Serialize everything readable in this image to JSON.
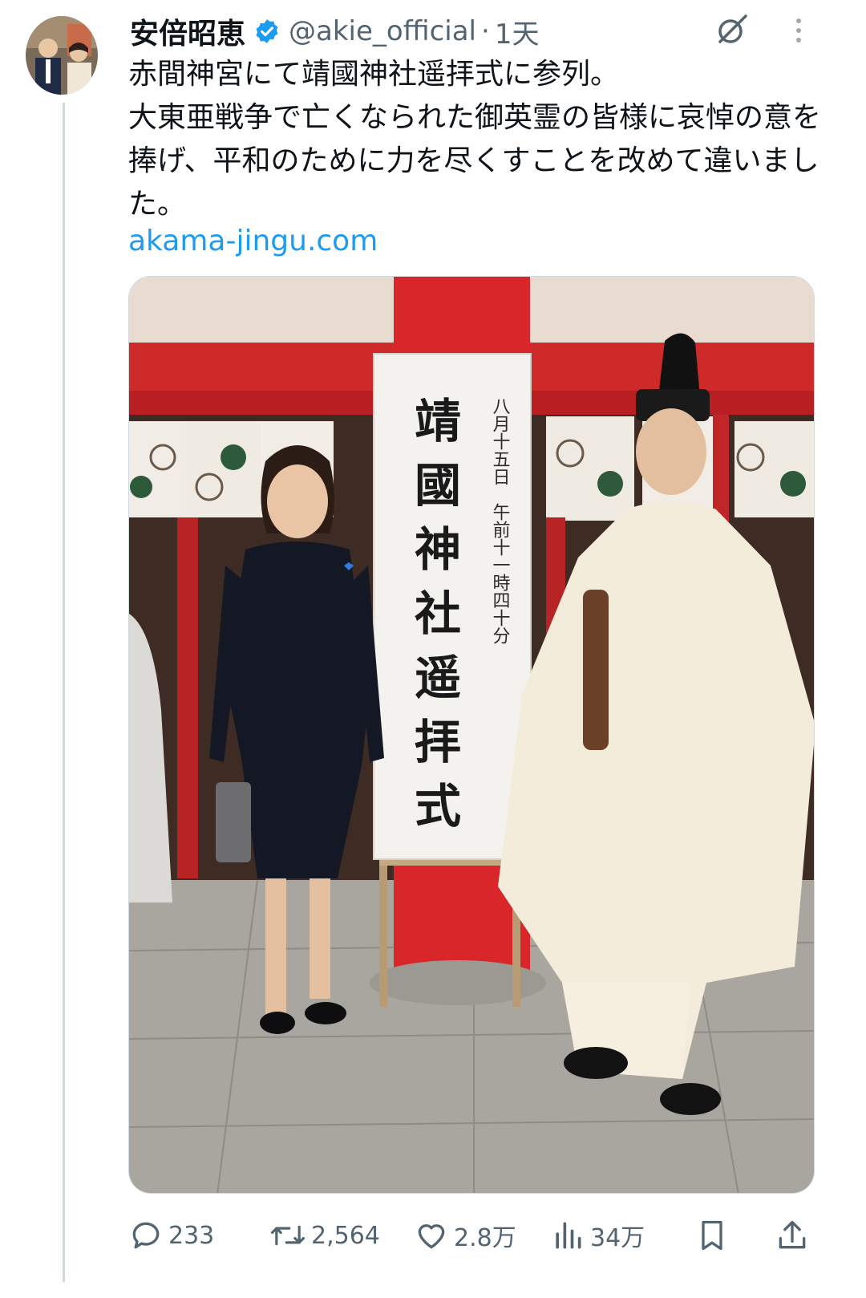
{
  "author": {
    "display_name": "安倍昭恵",
    "handle": "@akie_official",
    "separator": "·",
    "time": "1天"
  },
  "tweet": {
    "text": "赤間神宮にて靖國神社遥拝式に参列。\n大東亜戦争で亡くなられた御英霊の皆様に哀悼の意を捧げ、平和のために力を尽くすことを改めて違いました。",
    "link": "akama-jingu.com"
  },
  "media": {
    "banner_text": [
      "靖",
      "國",
      "神",
      "社",
      "遥",
      "拝",
      "式"
    ],
    "banner_date": "八月十五日　午前十一時四十分"
  },
  "actions": {
    "replies": "233",
    "retweets": "2,564",
    "likes": "2.8万",
    "views": "34万"
  },
  "icons": [
    "verified-badge-icon",
    "grok-icon",
    "more-icon",
    "reply-icon",
    "retweet-icon",
    "like-icon",
    "views-icon",
    "bookmark-icon",
    "share-icon"
  ],
  "colors": {
    "link": "#1d9bf0",
    "verified": "#1d9bf0",
    "muted": "#536471",
    "pillar": "#d8262b"
  }
}
